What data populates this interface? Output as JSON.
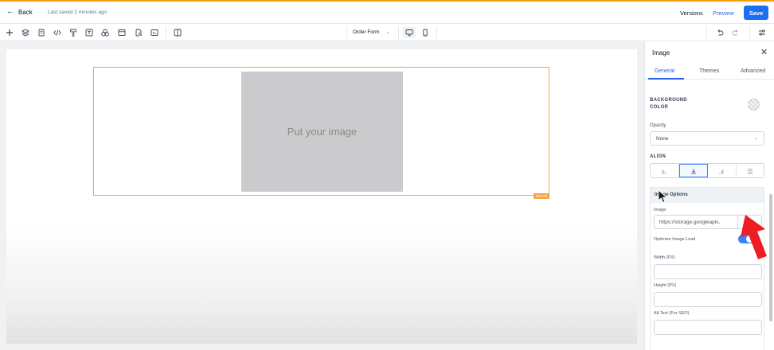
{
  "header": {
    "back_label": "Back",
    "saved_status": "Last saved 2 minutes ago",
    "versions_label": "Versions",
    "preview_label": "Preview",
    "save_label": "Save"
  },
  "toolbar": {
    "form_selector": "Order Form",
    "icons": [
      "plus-icon",
      "layers-icon",
      "pages-icon",
      "code-icon",
      "paint-roller-icon",
      "text-icon",
      "shapes-icon",
      "browser-window-icon",
      "file-search-icon",
      "terminal-icon",
      "columns-icon"
    ]
  },
  "canvas": {
    "image_placeholder_text": "Put your image",
    "element_tag": "IMAGE"
  },
  "panel": {
    "title": "Image",
    "tabs": [
      {
        "label": "General",
        "active": true
      },
      {
        "label": "Themes",
        "active": false
      },
      {
        "label": "Advanced",
        "active": false
      }
    ],
    "background_color_label_line1": "BACKGROUND",
    "background_color_label_line2": "COLOR",
    "opacity_label": "Opacity",
    "opacity_value": "None",
    "align_label": "ALIGN",
    "image_options": {
      "header": "Image Options",
      "image_label": "Image",
      "image_url": "https://storage.googleapis.",
      "optimize_label": "Optimize Image Load",
      "optimize_enabled": true,
      "width_label": "Width (PX)",
      "height_label": "Height (PX)",
      "alt_label": "Alt Text (For SEO)"
    }
  },
  "colors": {
    "accent": "#1d6ff2",
    "selection": "#f3a344",
    "placeholder": "#cbcacc",
    "annotation_arrow": "#ef1c23"
  }
}
